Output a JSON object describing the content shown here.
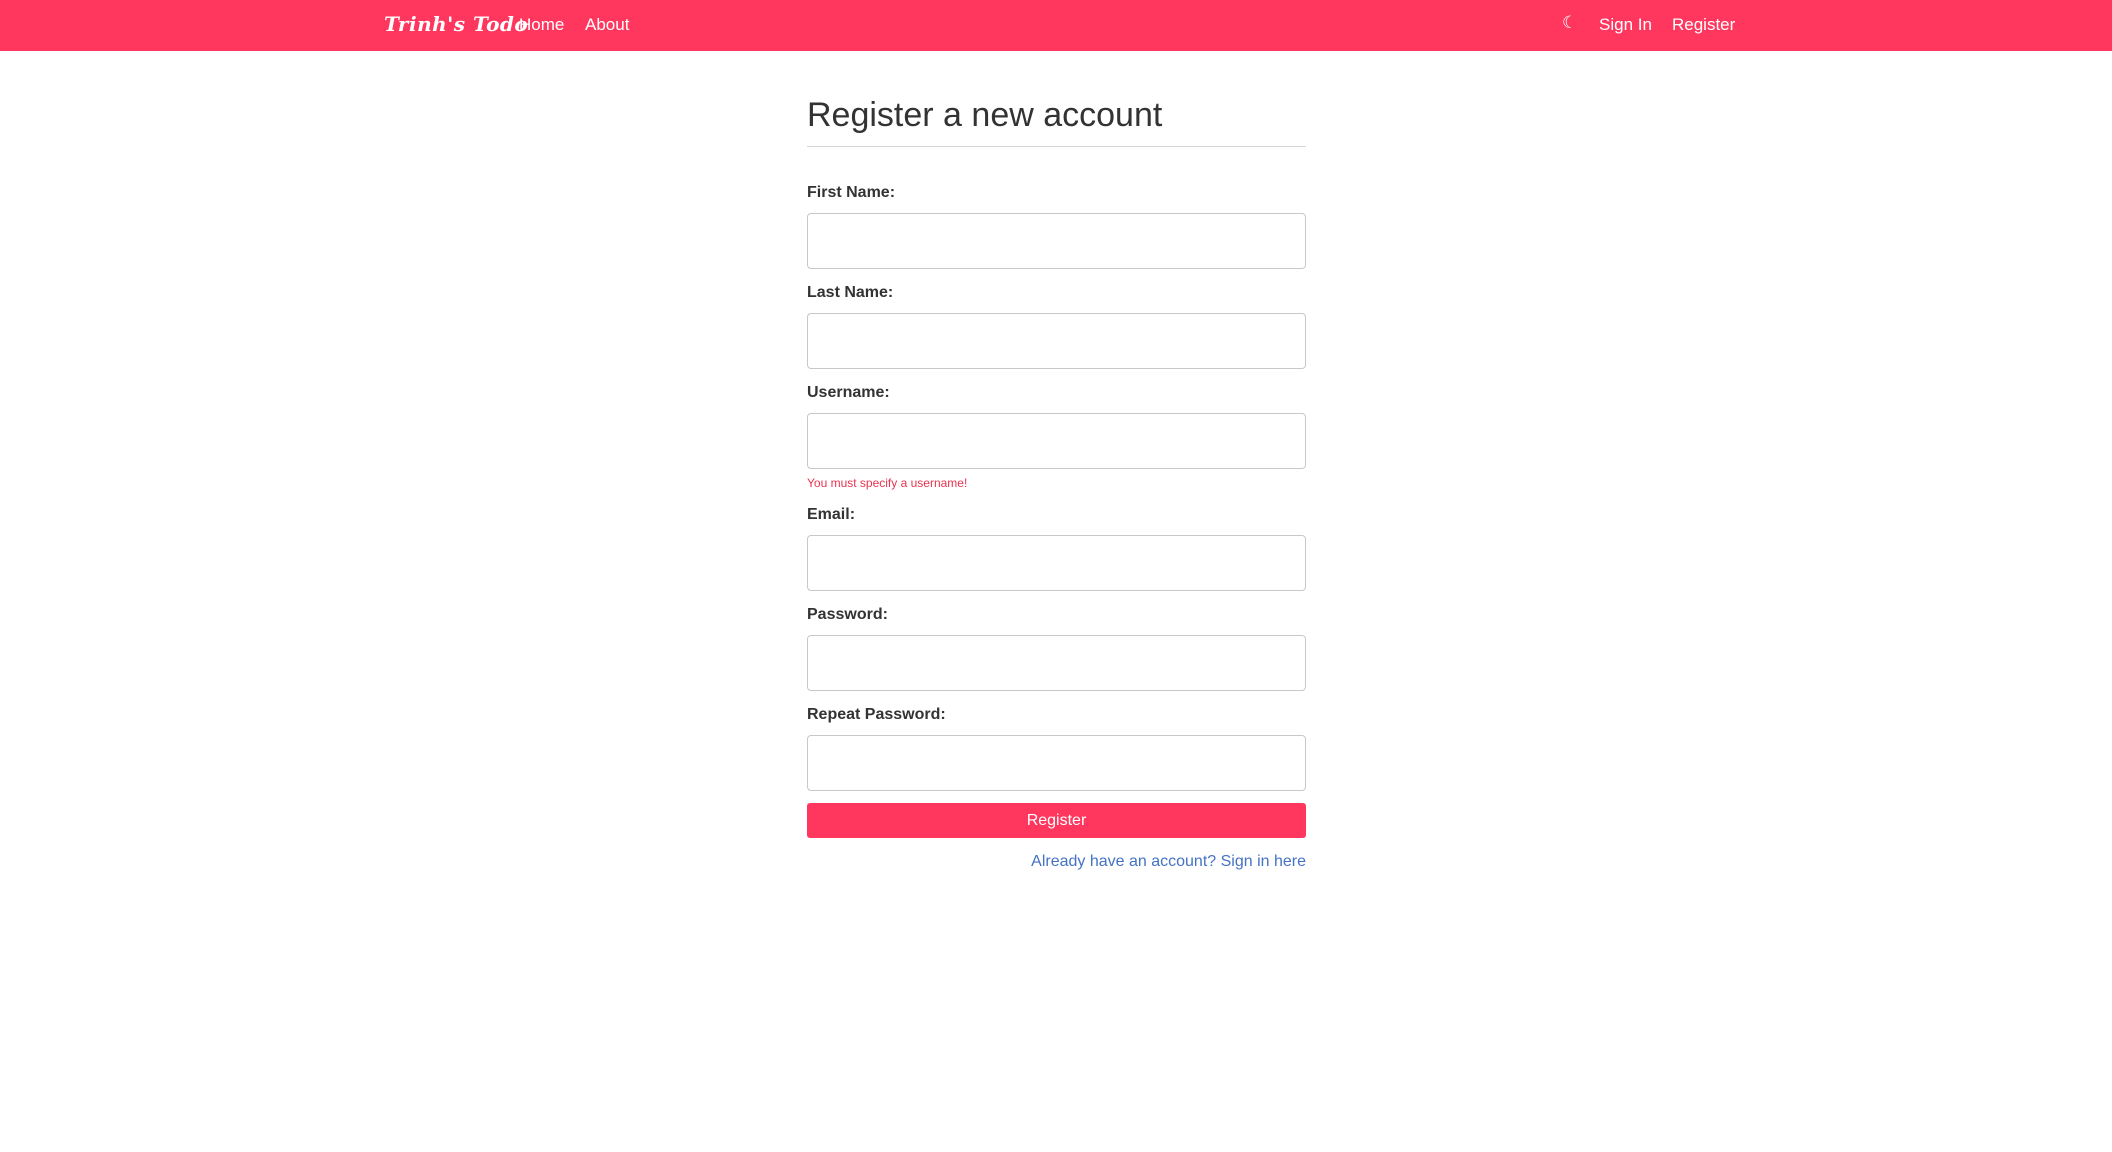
{
  "navbar": {
    "brand": "Trinh's Todo",
    "links": {
      "home": "Home",
      "about": "About"
    },
    "theme_toggle_icon": "moon-icon",
    "theme_toggle_glyph": "☾",
    "sign_in": "Sign In",
    "register": "Register",
    "background_color": "#ff375f"
  },
  "form": {
    "title": "Register a new account",
    "fields": {
      "first_name": {
        "label": "First Name:",
        "value": ""
      },
      "last_name": {
        "label": "Last Name:",
        "value": ""
      },
      "username": {
        "label": "Username:",
        "value": "",
        "error": "You must specify a username!"
      },
      "email": {
        "label": "Email:",
        "value": ""
      },
      "password": {
        "label": "Password:",
        "value": ""
      },
      "repeat_password": {
        "label": "Repeat Password:",
        "value": ""
      }
    },
    "submit_label": "Register",
    "signin_link": "Already have an account? Sign in here",
    "accent_color": "#ff375f",
    "error_color": "#e8334f",
    "link_color": "#4472c4"
  }
}
